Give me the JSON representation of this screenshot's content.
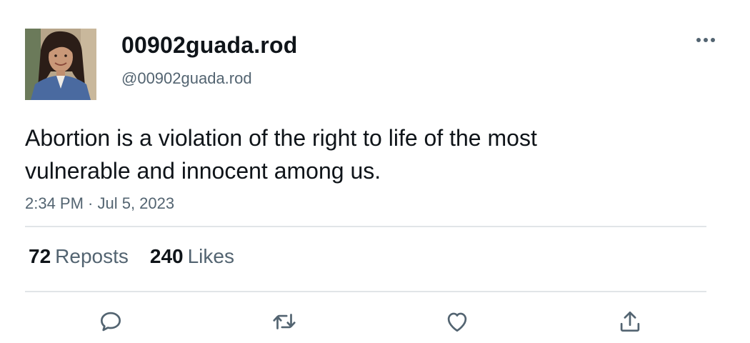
{
  "author": {
    "display_name": "00902guada.rod",
    "handle": "@00902guada.rod",
    "avatar": "profile-photo"
  },
  "tweet": {
    "text": "Abortion is a violation of the right to life of the most vulnerable and innocent among us.",
    "timestamp": "2:34 PM · Jul 5, 2023"
  },
  "stats": {
    "reposts_count": "72",
    "reposts_label": "Reposts",
    "likes_count": "240",
    "likes_label": "Likes"
  },
  "actions": {
    "reply_icon": "speech-bubble-icon",
    "repost_icon": "repost-arrows-icon",
    "like_icon": "heart-icon",
    "share_icon": "share-upload-icon",
    "more_icon": "more-dots-icon"
  },
  "colors": {
    "text_primary": "#0f1419",
    "text_secondary": "#536471",
    "divider": "#e1e5e8"
  }
}
